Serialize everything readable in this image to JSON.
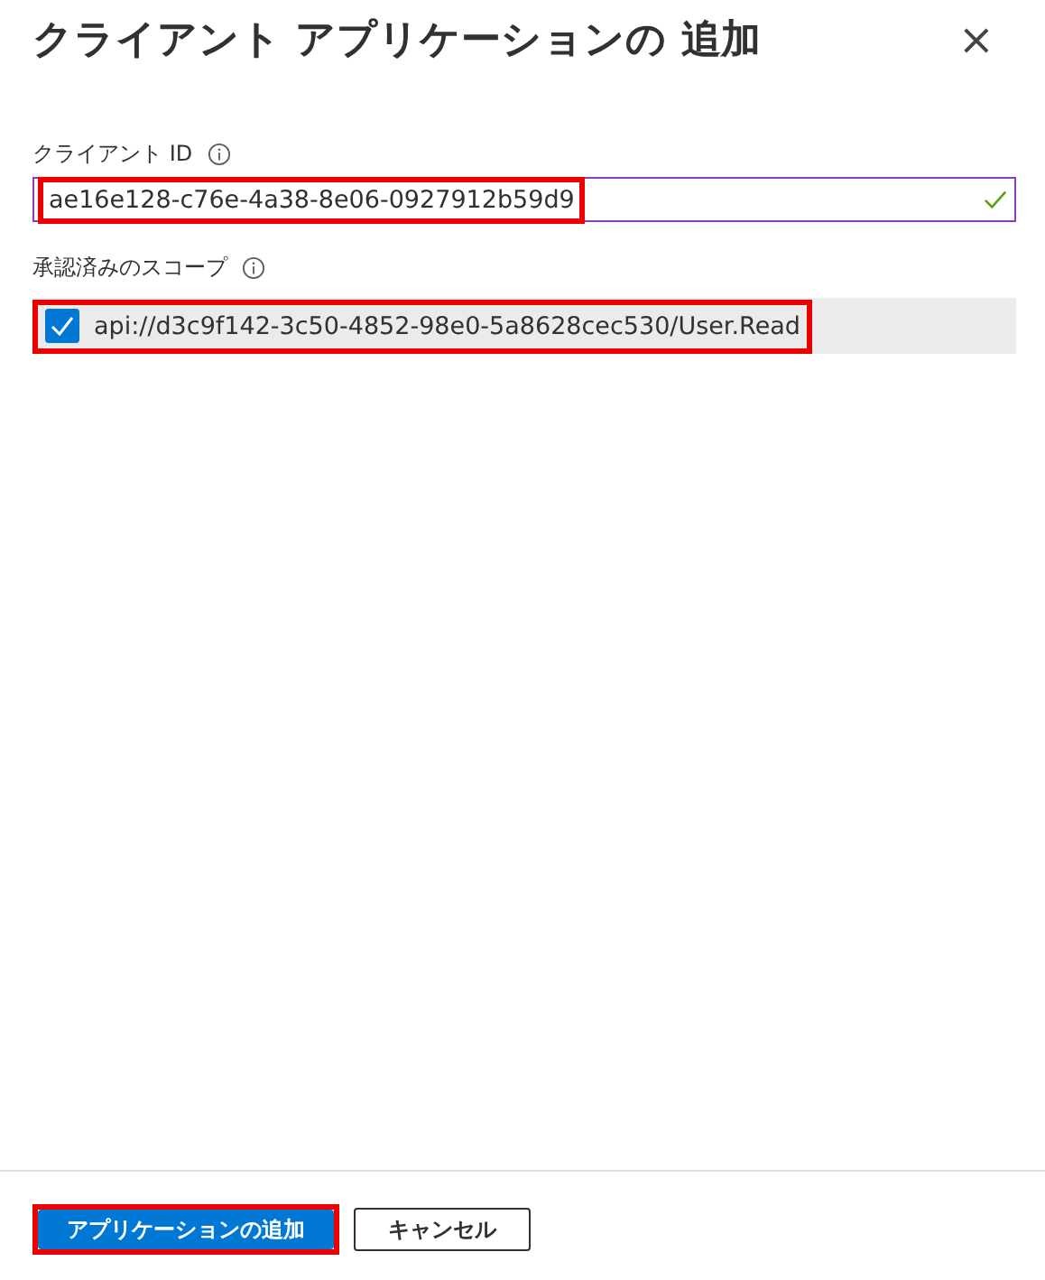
{
  "panel": {
    "title": "クライアント アプリケーションの 追加",
    "close": "×"
  },
  "client_id": {
    "label": "クライアント ID",
    "value": "ae16e128-c76e-4a38-8e06-0927912b59d9",
    "valid": true,
    "highlighted": true
  },
  "scopes": {
    "label": "承認済みのスコープ",
    "items": [
      {
        "label": "api://d3c9f142-3c50-4852-98e0-5a8628cec530/User.Read",
        "checked": true,
        "highlighted": true
      }
    ]
  },
  "buttons": [
    {
      "label": "アプリケーションの追加",
      "kind": "primary",
      "highlighted": true
    },
    {
      "label": "キャンセル",
      "kind": "secondary",
      "highlighted": false
    }
  ]
}
